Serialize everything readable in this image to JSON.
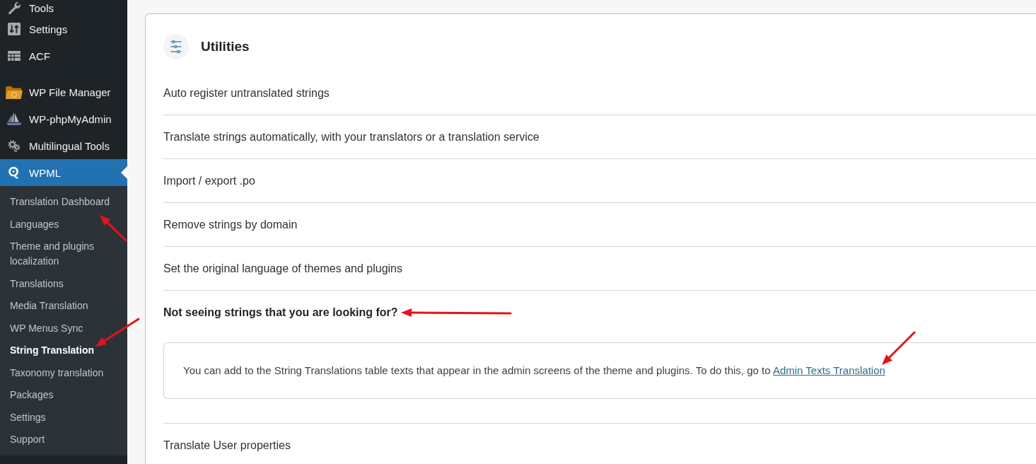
{
  "sidebar": {
    "groups": [
      {
        "items": [
          {
            "label": "Tools",
            "selected": false
          },
          {
            "label": "Settings",
            "selected": false
          },
          {
            "label": "ACF",
            "selected": false
          }
        ]
      },
      {
        "items": [
          {
            "label": "WP File Manager",
            "selected": false
          },
          {
            "label": "WP-phpMyAdmin",
            "selected": false
          },
          {
            "label": "Multilingual Tools",
            "selected": false
          },
          {
            "label": "WPML",
            "selected": true,
            "submenu": [
              {
                "label": "Translation Dashboard",
                "selected": false
              },
              {
                "label": "Languages",
                "selected": false
              },
              {
                "label": "Theme and plugins localization",
                "selected": false
              },
              {
                "label": "Translations",
                "selected": false
              },
              {
                "label": "Media Translation",
                "selected": false
              },
              {
                "label": "WP Menus Sync",
                "selected": false
              },
              {
                "label": "String Translation",
                "selected": true
              },
              {
                "label": "Taxonomy translation",
                "selected": false
              },
              {
                "label": "Packages",
                "selected": false
              },
              {
                "label": "Settings",
                "selected": false
              },
              {
                "label": "Support",
                "selected": false
              }
            ]
          }
        ]
      }
    ]
  },
  "utilities": {
    "title": "Utilities",
    "sections": [
      {
        "title": "Auto register untranslated strings",
        "expanded": false
      },
      {
        "title": "Translate strings automatically, with your translators or a translation service",
        "expanded": false
      },
      {
        "title": "Import / export .po",
        "expanded": false
      },
      {
        "title": "Remove strings by domain",
        "expanded": false
      },
      {
        "title": "Set the original language of themes and plugins",
        "expanded": false
      },
      {
        "title": "Not seeing strings that you are looking for?",
        "expanded": true,
        "notice": {
          "text": "You can add to the String Translations table texts that appear in the admin screens of the theme and plugins. To do this, go to",
          "link": "Admin Texts Translation"
        }
      },
      {
        "title": "Translate User properties",
        "expanded": false
      }
    ]
  },
  "annotations": [
    {
      "kind": "arrow"
    },
    {
      "kind": "arrow"
    },
    {
      "kind": "arrow"
    },
    {
      "kind": "arrow"
    }
  ]
}
